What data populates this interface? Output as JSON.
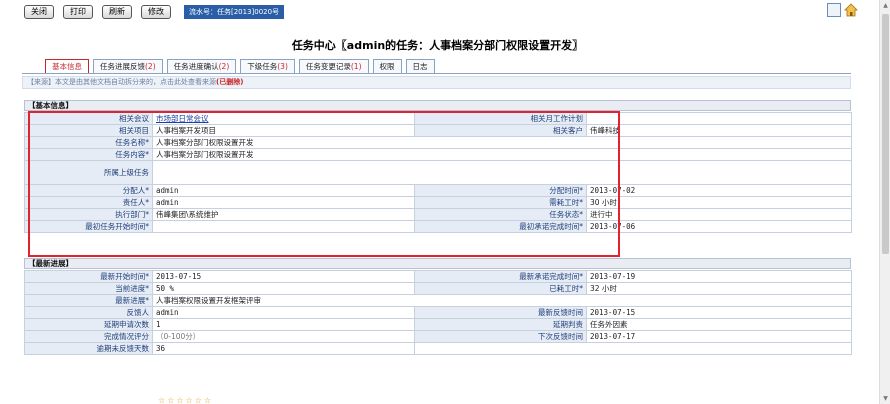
{
  "toolbar": {
    "close": "关闭",
    "print": "打印",
    "refresh": "刷新",
    "edit": "修改",
    "serial": "流水号：任务[2013]0020号"
  },
  "icons": {
    "print": "print-icon",
    "home": "home-icon"
  },
  "title": "任务中心〖admin的任务：人事档案分部门权限设置开发〗",
  "tabs": [
    {
      "label": "基本信息",
      "count": ""
    },
    {
      "label": "任务进展反馈",
      "count": "(2)"
    },
    {
      "label": "任务进度确认",
      "count": "(2)"
    },
    {
      "label": "下级任务",
      "count": "(3)"
    },
    {
      "label": "任务变更记录",
      "count": "(1)"
    },
    {
      "label": "权限",
      "count": ""
    },
    {
      "label": "日志",
      "count": ""
    }
  ],
  "source": {
    "text": "【来源】本文是由其他文档自动拆分来的，点击此处查看来源",
    "deleted": "(已删除)"
  },
  "basic": {
    "section": "【基本信息】",
    "meeting_label": "相关会议",
    "meeting": "市场部日常会议",
    "monthplan_label": "相关月工作计划",
    "monthplan": "",
    "project_label": "相关项目",
    "project": "人事档案开发项目",
    "customer_label": "相关客户",
    "customer": "伟峰科技",
    "name_label": "任务名称*",
    "name": "人事档案分部门权限设置开发",
    "content_label": "任务内容*",
    "content": "人事档案分部门权限设置开发",
    "parent_label": "所属上级任务",
    "parent": "",
    "assigner_label": "分配人*",
    "assigner": "admin",
    "assign_time_label": "分配时间*",
    "assign_time": "2013-07-02",
    "owner_label": "责任人*",
    "owner": "admin",
    "hours_label": "需耗工时*",
    "hours": "30 小时",
    "dept_label": "执行部门*",
    "dept": "伟峰集团\\系统维护",
    "status_label": "任务状态*",
    "status": "进行中",
    "start_label": "最初任务开始时间*",
    "start": "",
    "promise_label": "最初承诺完成时间*",
    "promise": "2013-07-06"
  },
  "progress": {
    "section": "【最新进展】",
    "latest_start_label": "最新开始时间*",
    "latest_start": "2013-07-15",
    "latest_promise_label": "最新承诺完成时间*",
    "latest_promise": "2013-07-19",
    "current_label": "当前进度*",
    "current": "50 %",
    "used_label": "已耗工时*",
    "used": "32 小时",
    "latest_progress_label": "最新进展*",
    "latest_progress": "人事档案权限设置开发框架评审",
    "feedback_user_label": "反馈人",
    "feedback_user": "admin",
    "latest_feedback_label": "最新反馈时间",
    "latest_feedback": "2013-07-15",
    "delay_count_label": "延期申请次数",
    "delay_count": "1",
    "delay_judge_label": "延期判责",
    "delay_judge": "任务外因素",
    "score_label": "完成情况评分",
    "score": "（0-100分）",
    "next_feedback_label": "下次反馈时间",
    "next_feedback": "2013-07-17",
    "overdue_label": "逾期未反馈天数",
    "overdue": "36"
  }
}
